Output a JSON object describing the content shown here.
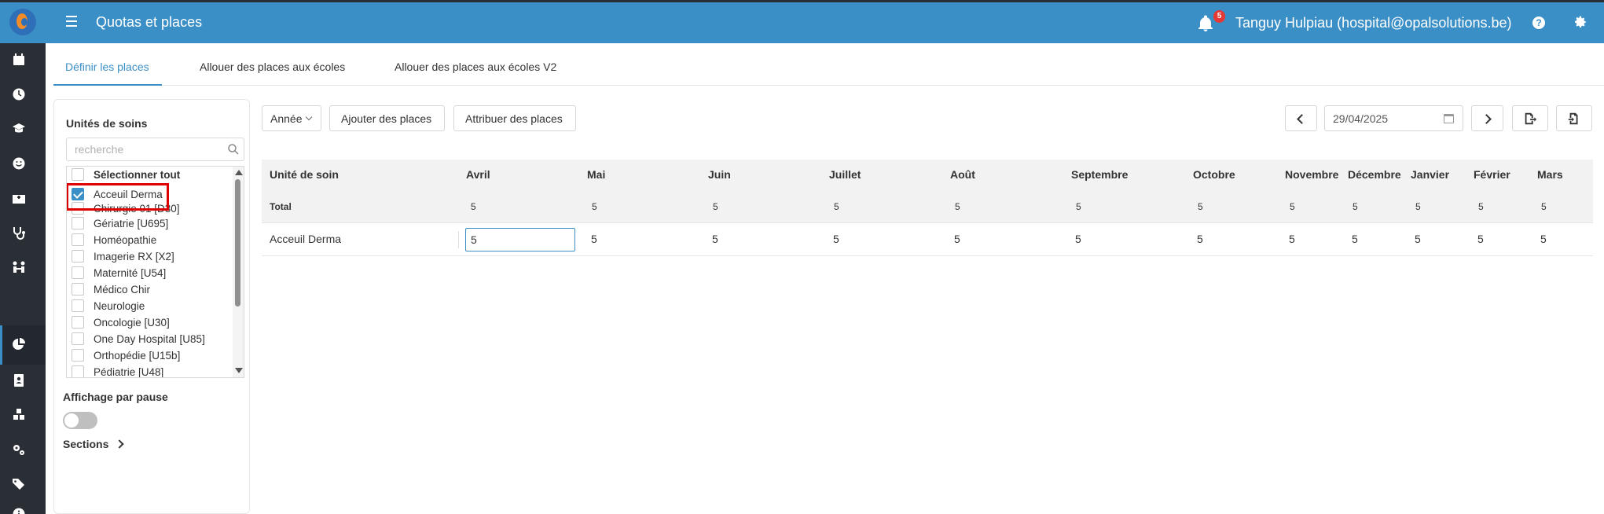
{
  "header": {
    "title": "Quotas et places",
    "notification_count": "5",
    "user": "Tanguy Hulpiau (hospital@opalsolutions.be)",
    "help_icon": "?",
    "colors": {
      "topbar": "#3b8fc7",
      "sidebar": "#2a2f36",
      "accent": "#3b8fc7"
    }
  },
  "sidebar": {
    "icons": [
      "calendar-icon",
      "clock-icon",
      "graduate-icon",
      "smiley-icon",
      "hospital-icon",
      "stethoscope-icon",
      "people-icon",
      "pie-chart-icon",
      "contact-card-icon",
      "cubes-icon",
      "cogs-icon",
      "tags-icon",
      "info-icon"
    ],
    "active": "pie-chart-icon"
  },
  "tabs": [
    {
      "label": "Définir les places",
      "active": true
    },
    {
      "label": "Allouer des places aux écoles",
      "active": false
    },
    {
      "label": "Allouer des places aux écoles V2",
      "active": false
    }
  ],
  "left_panel": {
    "title": "Unités de soins",
    "search_placeholder": "recherche",
    "select_all": "Sélectionner tout",
    "items": [
      {
        "label": "Acceuil Derma",
        "checked": true
      },
      {
        "label": "Chirurgie 01 [D30]",
        "checked": false
      },
      {
        "label": "Gériatrie [U695]",
        "checked": false
      },
      {
        "label": "Homéopathie",
        "checked": false
      },
      {
        "label": "Imagerie RX [X2]",
        "checked": false
      },
      {
        "label": "Maternité [U54]",
        "checked": false
      },
      {
        "label": "Médico Chir",
        "checked": false
      },
      {
        "label": "Neurologie",
        "checked": false
      },
      {
        "label": "Oncologie [U30]",
        "checked": false
      },
      {
        "label": "One Day Hospital [U85]",
        "checked": false
      },
      {
        "label": "Orthopédie [U15b]",
        "checked": false
      },
      {
        "label": "Pédiatrie [U48]",
        "checked": false
      }
    ],
    "pause_label": "Affichage par pause",
    "pause_toggle_on": false,
    "sections_label": "Sections"
  },
  "toolbar": {
    "year_label": "Année",
    "add_label": "Ajouter des places",
    "assign_label": "Attribuer des places",
    "date_value": "29/04/2025"
  },
  "table": {
    "unit_header": "Unité de soin",
    "months": [
      "Avril",
      "Mai",
      "Juin",
      "Juillet",
      "Août",
      "Septembre",
      "Octobre",
      "Novembre",
      "Décembre",
      "Janvier",
      "Février",
      "Mars"
    ],
    "total_label": "Total",
    "totals": [
      "5",
      "5",
      "5",
      "5",
      "5",
      "5",
      "5",
      "5",
      "5",
      "5",
      "5",
      "5"
    ],
    "rows": [
      {
        "unit": "Acceuil Derma",
        "values": [
          "5",
          "5",
          "5",
          "5",
          "5",
          "5",
          "5",
          "5",
          "5",
          "5",
          "5",
          "5"
        ]
      }
    ]
  }
}
